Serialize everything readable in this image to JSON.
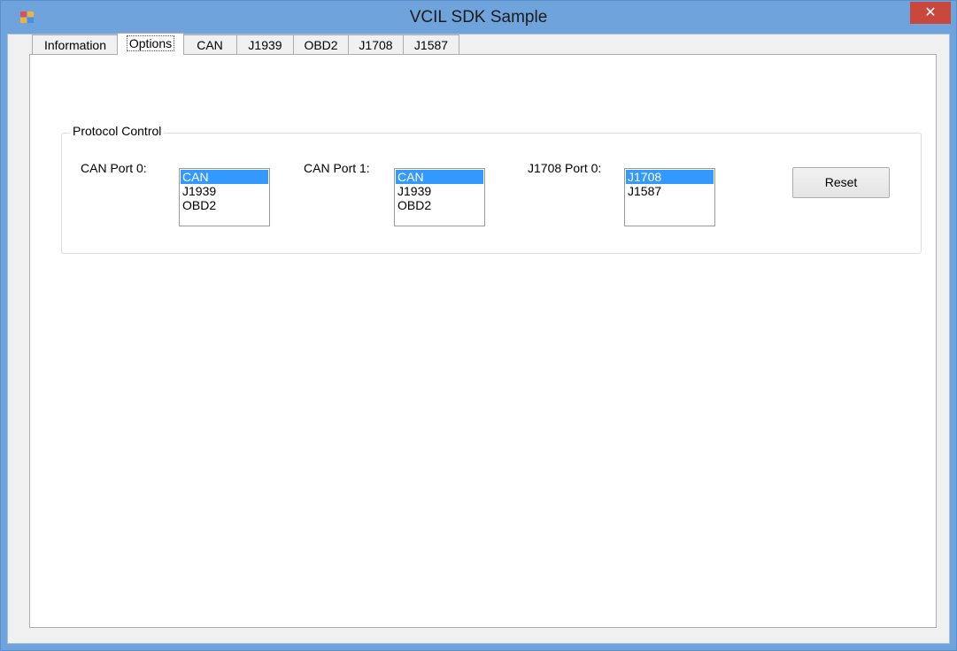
{
  "window": {
    "title": "VCIL SDK Sample",
    "close_glyph": "✕",
    "accent_color": "#6fa3dc",
    "close_color": "#c9483d"
  },
  "tabs": [
    {
      "label": "Information",
      "active": false
    },
    {
      "label": "Options",
      "active": true
    },
    {
      "label": "CAN",
      "active": false
    },
    {
      "label": "J1939",
      "active": false
    },
    {
      "label": "OBD2",
      "active": false
    },
    {
      "label": "J1708",
      "active": false
    },
    {
      "label": "J1587",
      "active": false
    }
  ],
  "protocol_control": {
    "title": "Protocol Control",
    "can_port0": {
      "label": "CAN Port 0:",
      "items": [
        "CAN",
        "J1939",
        "OBD2"
      ],
      "selected": "CAN"
    },
    "can_port1": {
      "label": "CAN Port 1:",
      "items": [
        "CAN",
        "J1939",
        "OBD2"
      ],
      "selected": "CAN"
    },
    "j1708_port0": {
      "label": "J1708 Port 0:",
      "items": [
        "J1708",
        "J1587"
      ],
      "selected": "J1708"
    },
    "reset_label": "Reset"
  },
  "selection_color": "#3399ff"
}
